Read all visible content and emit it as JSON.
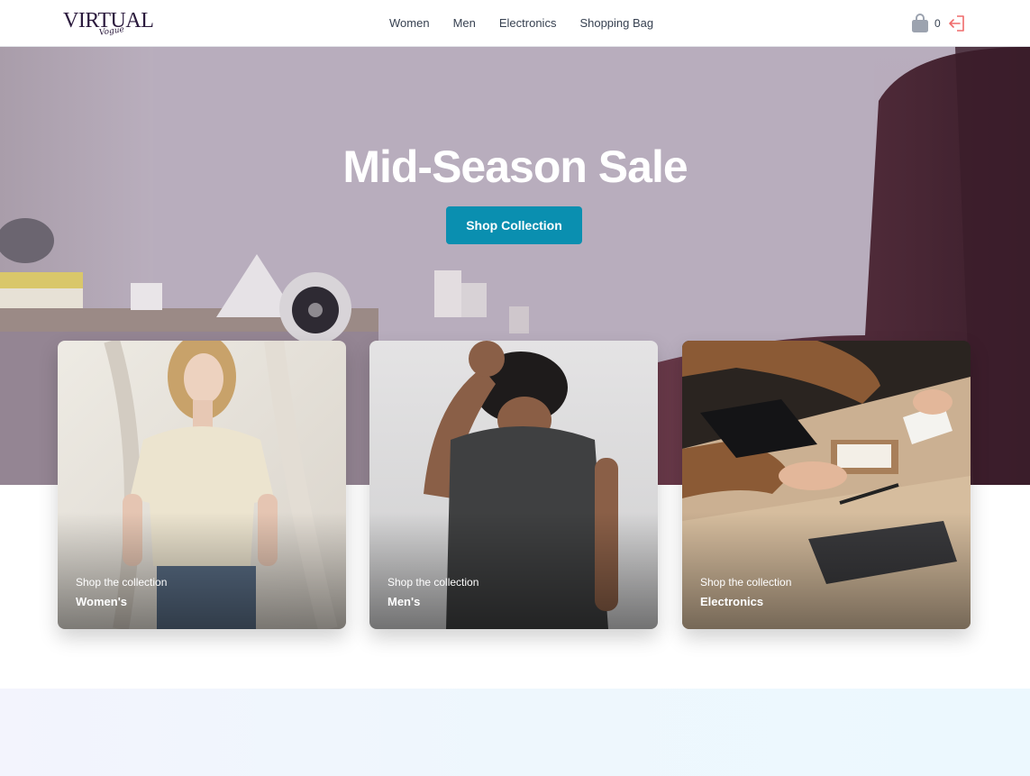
{
  "header": {
    "logo_text": "VIRTUAL",
    "logo_script": "Vogue",
    "nav": [
      "Women",
      "Men",
      "Electronics",
      "Shopping Bag"
    ],
    "cart_count": "0"
  },
  "hero": {
    "title": "Mid-Season Sale",
    "button_label": "Shop Collection"
  },
  "categories": [
    {
      "subtitle": "Shop the collection",
      "title": "Women's"
    },
    {
      "subtitle": "Shop the collection",
      "title": "Men's"
    },
    {
      "subtitle": "Shop the collection",
      "title": "Electronics"
    }
  ],
  "colors": {
    "accent": "#0a8fb0",
    "logout_icon": "#ef6b6b",
    "cart_icon": "#9ca3af",
    "logo": "#2b1a3d"
  },
  "icons": [
    "shopping-bag-icon",
    "logout-icon"
  ]
}
